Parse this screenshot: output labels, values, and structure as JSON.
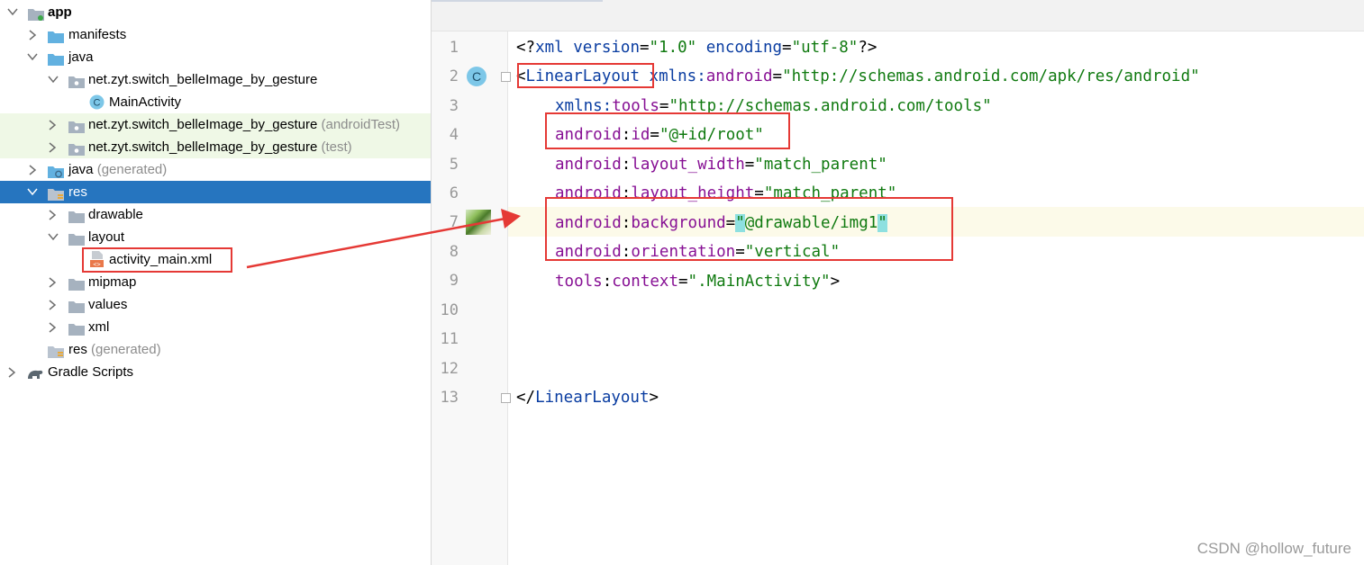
{
  "project_tree": {
    "items": [
      {
        "label": "app",
        "suffix": "",
        "icon": "module-folder-icon",
        "expanded": true
      },
      {
        "label": "manifests",
        "suffix": "",
        "icon": "folder-icon",
        "expanded": false
      },
      {
        "label": "java",
        "suffix": "",
        "icon": "folder-icon",
        "expanded": true
      },
      {
        "label": "net.zyt.switch_belleImage_by_gesture",
        "suffix": "",
        "icon": "package-icon",
        "expanded": true
      },
      {
        "label": "MainActivity",
        "suffix": "",
        "icon": "class-icon"
      },
      {
        "label": "net.zyt.switch_belleImage_by_gesture",
        "suffix": " (androidTest)",
        "icon": "package-icon",
        "expanded": false
      },
      {
        "label": "net.zyt.switch_belleImage_by_gesture",
        "suffix": " (test)",
        "icon": "package-icon",
        "expanded": false
      },
      {
        "label": "java",
        "suffix": " (generated)",
        "icon": "generated-folder-icon",
        "expanded": false
      },
      {
        "label": "res",
        "suffix": "",
        "icon": "res-folder-icon",
        "expanded": true
      },
      {
        "label": "drawable",
        "suffix": "",
        "icon": "folder-icon",
        "expanded": false
      },
      {
        "label": "layout",
        "suffix": "",
        "icon": "folder-icon",
        "expanded": true
      },
      {
        "label": "activity_main.xml",
        "suffix": "",
        "icon": "xml-file-icon"
      },
      {
        "label": "mipmap",
        "suffix": "",
        "icon": "folder-icon",
        "expanded": false
      },
      {
        "label": "values",
        "suffix": "",
        "icon": "folder-icon",
        "expanded": false
      },
      {
        "label": "xml",
        "suffix": "",
        "icon": "folder-icon",
        "expanded": false
      },
      {
        "label": "res",
        "suffix": " (generated)",
        "icon": "res-folder-icon"
      },
      {
        "label": "Gradle Scripts",
        "suffix": "",
        "icon": "gradle-icon",
        "expanded": false
      }
    ]
  },
  "editor": {
    "line_numbers": [
      "1",
      "2",
      "3",
      "4",
      "5",
      "6",
      "7",
      "8",
      "9",
      "10",
      "11",
      "12",
      "13"
    ],
    "gutter_class_badge": "C",
    "lines": {
      "l1": {
        "t1": "<?",
        "t2": "xml",
        "t3": " version",
        "t4": "=",
        "t5": "\"1.0\"",
        "t6": " encoding",
        "t7": "=",
        "t8": "\"utf-8\"",
        "t9": "?>"
      },
      "l2": {
        "t1": "<",
        "t2": "LinearLayout",
        "t3": " ",
        "t4": "xmlns:",
        "t5": "android",
        "t6": "=",
        "t7": "\"http://schemas.android.com/apk/res/android\""
      },
      "l3": {
        "t1": "xmlns:",
        "t2": "tools",
        "t3": "=",
        "t4": "\"http://schemas.android.com/tools\""
      },
      "l4": {
        "t1": "android",
        "t2": ":",
        "t3": "id",
        "t4": "=",
        "t5": "\"@+id/root\""
      },
      "l5": {
        "t1": "android",
        "t2": ":",
        "t3": "layout_width",
        "t4": "=",
        "t5": "\"match_parent\""
      },
      "l6": {
        "t1": "android",
        "t2": ":",
        "t3": "layout_height",
        "t4": "=",
        "t5": "\"match_parent\""
      },
      "l7": {
        "t1": "android",
        "t2": ":",
        "t3": "background",
        "t4": "=",
        "t5": "\"",
        "t6": "@drawable/img1",
        "t7": "\""
      },
      "l8": {
        "t1": "android",
        "t2": ":",
        "t3": "orientation",
        "t4": "=",
        "t5": "\"vertical\""
      },
      "l9": {
        "t1": "tools",
        "t2": ":",
        "t3": "context",
        "t4": "=",
        "t5": "\".MainActivity\"",
        "t6": ">"
      },
      "l13": {
        "t1": "</",
        "t2": "LinearLayout",
        "t3": ">"
      }
    }
  },
  "watermark": "CSDN @hollow_future",
  "colors": {
    "selection": "#2675bf",
    "annotation_red": "#e53935",
    "xml_tag": "#0a3da1",
    "xml_attr": "#871094",
    "xml_value": "#107a10"
  }
}
